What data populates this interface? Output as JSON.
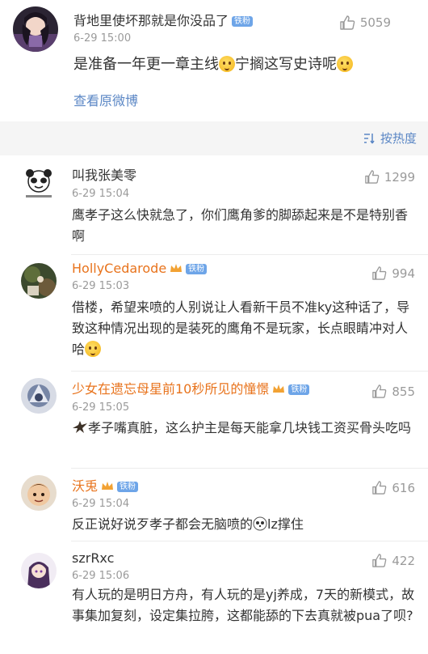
{
  "top_post": {
    "username": "背地里使坏那就是你没品了",
    "badge": "铁粉",
    "time": "6-29 15:00",
    "likes": "5059",
    "content": "是准备一年更一章主线",
    "content_2": "宁搁这写史诗呢",
    "view_original": "查看原微博"
  },
  "sort": {
    "label": "按热度",
    "icon": "sort-icon"
  },
  "comments": [
    {
      "username": "叫我张美零",
      "time": "6-29 15:04",
      "likes": "1299",
      "content": "鹰孝子这么快就急了，你们鹰角爹的脚舔起来是不是特别香啊"
    },
    {
      "username": "HollyCedarode",
      "badge": "铁粉",
      "time": "6-29 15:03",
      "likes": "994",
      "content": "借楼，希望来喷的人别说让人看新干员不准ky这种话了，导致这种情况出现的是装死的鹰角不是玩家，长点眼睛冲对人哈"
    },
    {
      "username": "少女在遗忘母星前10秒所见的憧憬",
      "badge": "铁粉",
      "time": "6-29 15:05",
      "likes": "855",
      "content": "孝子嘴真脏，这么护主是每天能拿几块钱工资买骨头吃吗"
    },
    {
      "username": "沃兎",
      "badge": "铁粉",
      "time": "6-29 15:04",
      "likes": "616",
      "content": "反正说好说歹孝子都会无脑喷的",
      "content_2": "lz撑住"
    },
    {
      "username": "szrRxc",
      "time": "6-29 15:06",
      "likes": "422",
      "content": "有人玩的是明日方舟，有人玩的是yj养成，7天的新模式，故事集加复刻，设定集拉胯，这都能舔的下去真就被pua了呗?"
    }
  ],
  "colors": {
    "link_blue": "#5b87c5",
    "vip_orange": "#e8731c",
    "badge_blue": "#6ea5e8",
    "meta_gray": "#9a9a9a"
  }
}
